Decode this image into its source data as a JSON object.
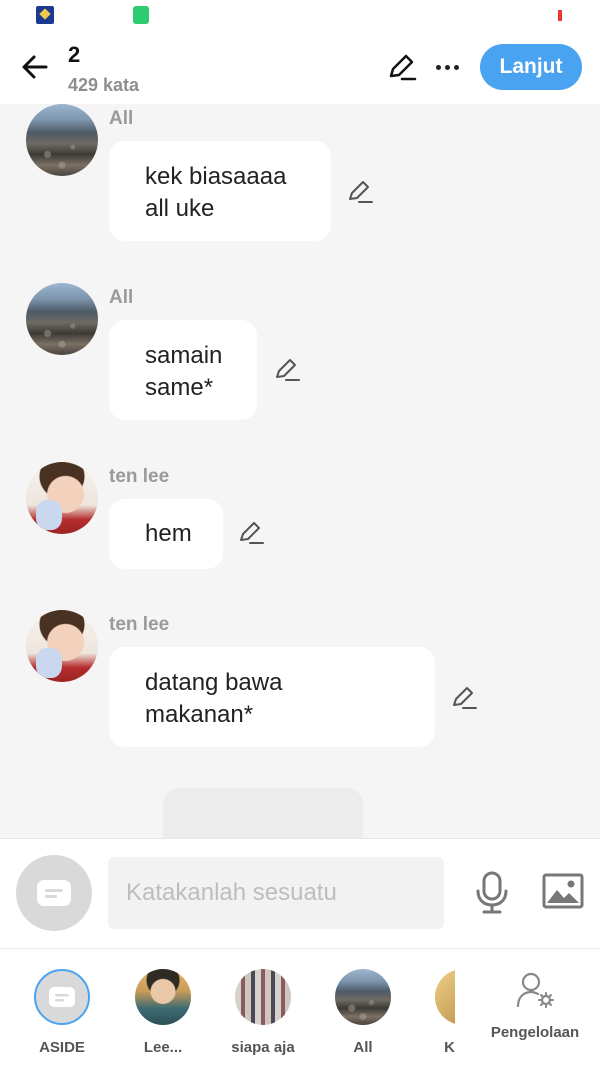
{
  "header": {
    "title": "2",
    "subtitle": "429 kata",
    "next_label": "Lanjut"
  },
  "messages": [
    {
      "sender": "All",
      "text": "kek biasaaaa\nall uke",
      "avatar": "sea-photo"
    },
    {
      "sender": "All",
      "text": "samain\nsame*",
      "avatar": "sea-photo"
    },
    {
      "sender": "ten lee",
      "text": "hem",
      "avatar": "person-photo"
    },
    {
      "sender": "ten lee",
      "text": "datang bawa\nmakanan*",
      "avatar": "person-photo"
    }
  ],
  "composer": {
    "placeholder": "Katakanlah sesuatu"
  },
  "tabs": [
    {
      "label": "ASIDE"
    },
    {
      "label": "Lee..."
    },
    {
      "label": "siapa aja"
    },
    {
      "label": "All"
    },
    {
      "label": "K"
    }
  ],
  "manage_label": "Pengelolaan",
  "icons": {
    "back": "arrow-left-icon",
    "edit": "pencil-icon",
    "more": "more-horizontal-icon",
    "mic": "microphone-icon",
    "image": "image-icon",
    "manage": "user-gear-icon",
    "chat": "chat-bubble-icon"
  },
  "colors": {
    "accent": "#4aa3f0",
    "background": "#f5f5f5",
    "bubble": "#ffffff"
  }
}
